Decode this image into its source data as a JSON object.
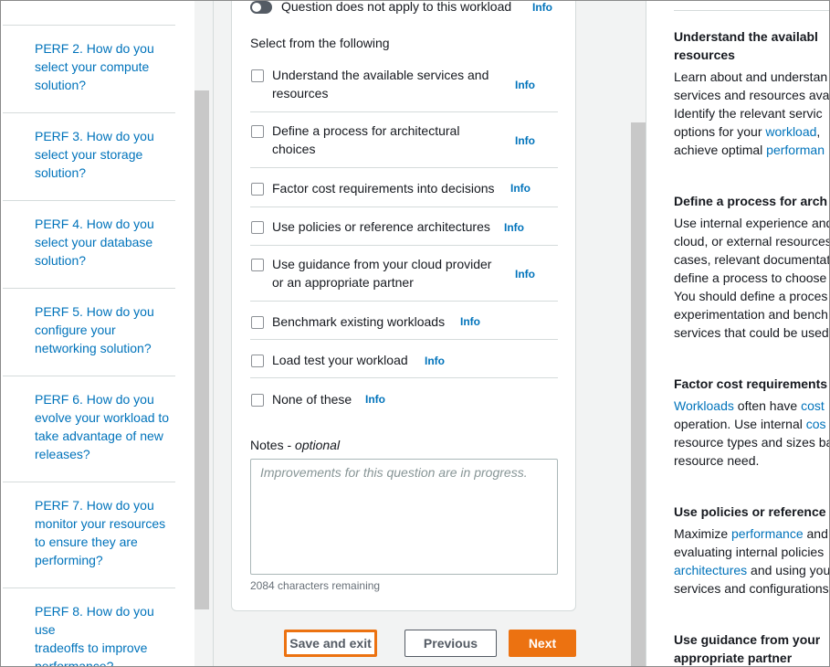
{
  "nav": {
    "items": [
      {
        "id": "perf2",
        "lines": [
          "PERF 2. How do you",
          "select your compute",
          "solution?"
        ]
      },
      {
        "id": "perf3",
        "lines": [
          "PERF 3. How do you",
          "select your storage",
          "solution?"
        ]
      },
      {
        "id": "perf4",
        "lines": [
          "PERF 4. How do you",
          "select your database",
          "solution?"
        ]
      },
      {
        "id": "perf5",
        "lines": [
          "PERF 5. How do you",
          "configure your",
          "networking solution?"
        ]
      },
      {
        "id": "perf6",
        "lines": [
          "PERF 6. How do you",
          "evolve your workload to",
          "take advantage of new",
          "releases?"
        ]
      },
      {
        "id": "perf7",
        "lines": [
          "PERF 7. How do you",
          "monitor your resources",
          "to ensure they are",
          "performing?"
        ]
      },
      {
        "id": "perf8",
        "lines": [
          "PERF 8. How do you use",
          "tradeoffs to improve",
          "performance?"
        ]
      }
    ]
  },
  "question": {
    "not_applicable_label": "Question does not apply to this workload",
    "info_label": "Info",
    "select_prompt": "Select from the following",
    "options": [
      {
        "lines": [
          "Understand the available services and",
          "resources"
        ]
      },
      {
        "lines": [
          "Define a process for architectural",
          "choices"
        ]
      },
      {
        "lines": [
          "Factor cost requirements into decisions"
        ]
      },
      {
        "lines": [
          "Use policies or reference architectures"
        ]
      },
      {
        "lines": [
          "Use guidance from your cloud provider",
          "or an appropriate partner"
        ]
      },
      {
        "lines": [
          "Benchmark existing workloads"
        ]
      },
      {
        "lines": [
          "Load test your workload"
        ]
      },
      {
        "lines": [
          "None of these"
        ]
      }
    ],
    "notes_label": "Notes",
    "notes_optional": "optional",
    "notes_separator": " - ",
    "notes_placeholder": "Improvements for this question are in progress.",
    "chars_remaining": "2084 characters remaining"
  },
  "buttons": {
    "save": "Save and exit",
    "previous": "Previous",
    "next": "Next"
  },
  "help": {
    "sections": [
      {
        "heading": [
          "Understand the availabl",
          "resources"
        ],
        "body": [
          [
            {
              "t": "Learn about and understan"
            }
          ],
          [
            {
              "t": "services and resources avail"
            }
          ],
          [
            {
              "t": "Identify the relevant servic"
            }
          ],
          [
            {
              "t": "options for your "
            },
            {
              "t": "workload",
              "link": true
            },
            {
              "t": ","
            }
          ],
          [
            {
              "t": "achieve optimal "
            },
            {
              "t": "performan",
              "link": true
            }
          ]
        ]
      },
      {
        "heading": [
          "Define a process for arch"
        ],
        "body": [
          [
            {
              "t": "Use internal experience and"
            }
          ],
          [
            {
              "t": "cloud, or external resources"
            }
          ],
          [
            {
              "t": "cases, relevant documentat"
            }
          ],
          [
            {
              "t": "define a process to choose"
            }
          ],
          [
            {
              "t": "You should define a proces"
            }
          ],
          [
            {
              "t": "experimentation and bench"
            }
          ],
          [
            {
              "t": "services that could be used"
            }
          ]
        ]
      },
      {
        "heading": [
          "Factor cost requirements"
        ],
        "body": [
          [
            {
              "t": "Workloads",
              "link": true
            },
            {
              "t": " often have "
            },
            {
              "t": "cost",
              "link": true
            }
          ],
          [
            {
              "t": "operation. Use internal "
            },
            {
              "t": "cos",
              "link": true
            }
          ],
          [
            {
              "t": "resource types and sizes ba"
            }
          ],
          [
            {
              "t": "resource need."
            }
          ]
        ]
      },
      {
        "heading": [
          "Use policies or reference"
        ],
        "body": [
          [
            {
              "t": "Maximize "
            },
            {
              "t": "performance",
              "link": true
            },
            {
              "t": " and"
            }
          ],
          [
            {
              "t": "evaluating internal policies"
            }
          ],
          [
            {
              "t": "architectures",
              "link": true
            },
            {
              "t": " and using you"
            }
          ],
          [
            {
              "t": "services and configurations"
            }
          ]
        ]
      },
      {
        "heading": [
          "Use guidance from your",
          "appropriate partner"
        ],
        "body": []
      }
    ]
  },
  "colors": {
    "link": "#0073bb",
    "primary": "#ec7211",
    "focus_outline": "#ec7211",
    "text": "#16191f",
    "border": "#d5dbdb"
  }
}
